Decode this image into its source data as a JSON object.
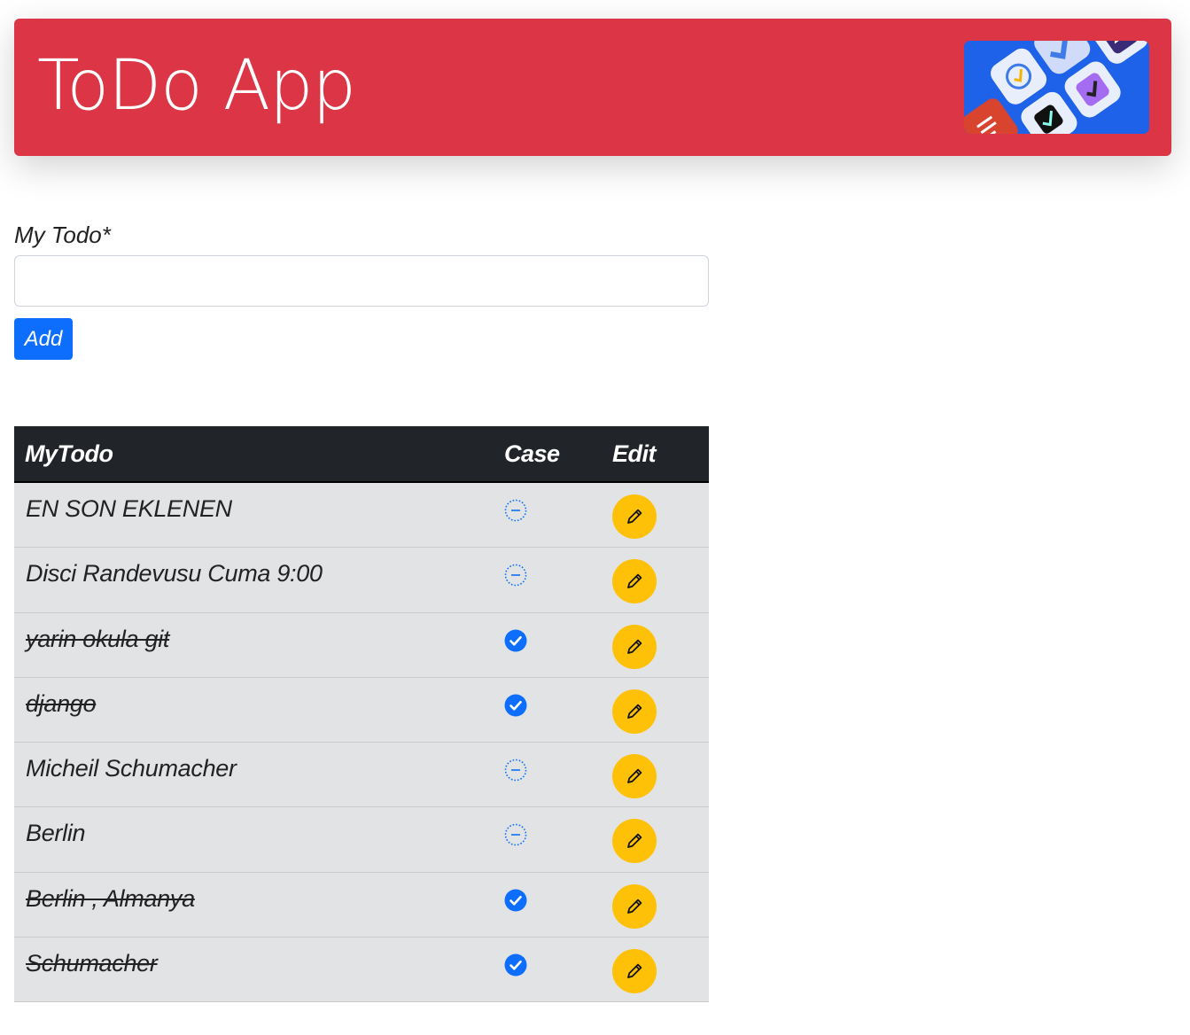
{
  "header": {
    "title": "ToDo App",
    "logo_icon": "todo-apps-collage-logo"
  },
  "form": {
    "label": "My Todo*",
    "input_value": "",
    "input_placeholder": "",
    "add_label": "Add"
  },
  "table": {
    "headers": {
      "todo": "MyTodo",
      "case": "Case",
      "edit": "Edit"
    },
    "rows": [
      {
        "text": "EN SON EKLENEN",
        "done": false
      },
      {
        "text": "Disci Randevusu Cuma 9:00",
        "done": false
      },
      {
        "text": "yarin okula git",
        "done": true
      },
      {
        "text": "django",
        "done": true
      },
      {
        "text": "Micheil Schumacher",
        "done": false
      },
      {
        "text": "Berlin",
        "done": false
      },
      {
        "text": "Berlin , Almanya",
        "done": true
      },
      {
        "text": "Schumacher",
        "done": true
      }
    ]
  },
  "colors": {
    "header_bg": "#dc3545",
    "primary": "#0d6efd",
    "warning": "#ffc107",
    "table_head": "#212529",
    "row_bg": "#e2e3e5"
  },
  "icons": {
    "pending": "dash-circle-dotted-icon",
    "done": "check-circle-fill-icon",
    "edit": "pencil-icon"
  }
}
